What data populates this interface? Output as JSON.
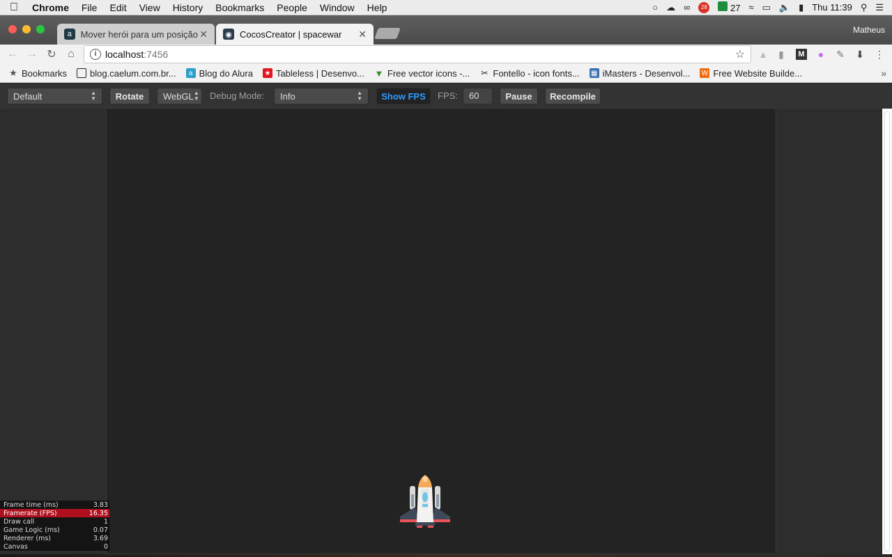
{
  "menubar": {
    "app": "Chrome",
    "items": [
      "File",
      "Edit",
      "View",
      "History",
      "Bookmarks",
      "People",
      "Window",
      "Help"
    ],
    "badge_count": "28",
    "status_count": "27",
    "clock": "Thu 11:39"
  },
  "tabs": [
    {
      "title": "Mover herói para um posição f",
      "favicon": "alura-icon"
    },
    {
      "title": "CocosCreator | spacewar",
      "favicon": "cocos-icon"
    }
  ],
  "profile_name": "Matheus",
  "address": {
    "host": "localhost",
    "port": ":7456"
  },
  "bookmarks": [
    {
      "label": "Bookmarks",
      "icon": "star-icon"
    },
    {
      "label": "blog.caelum.com.br...",
      "icon": "page-icon"
    },
    {
      "label": "Blog do Alura",
      "icon": "alura-icon"
    },
    {
      "label": "Tableless | Desenvo...",
      "icon": "tableless-icon"
    },
    {
      "label": "Free vector icons -...",
      "icon": "freepik-icon"
    },
    {
      "label": "Fontello - icon fonts...",
      "icon": "scissors-icon"
    },
    {
      "label": "iMasters - Desenvol...",
      "icon": "imasters-icon"
    },
    {
      "label": "Free Website Builde...",
      "icon": "wix-icon"
    }
  ],
  "cocos": {
    "device": "Default",
    "rotate": "Rotate",
    "renderer": "WebGL",
    "debug_label": "Debug Mode:",
    "debug_value": "Info",
    "show_fps": "Show FPS",
    "fps_label": "FPS:",
    "fps_value": "60",
    "pause": "Pause",
    "recompile": "Recompile"
  },
  "stats": [
    {
      "label": "Frame time (ms)",
      "value": "3.83"
    },
    {
      "label": "Framerate (FPS)",
      "value": "16.35"
    },
    {
      "label": "Draw call",
      "value": "1"
    },
    {
      "label": "Game Logic (ms)",
      "value": "0.07"
    },
    {
      "label": "Renderer (ms)",
      "value": "3.69"
    },
    {
      "label": "Canvas",
      "value": "0"
    }
  ]
}
